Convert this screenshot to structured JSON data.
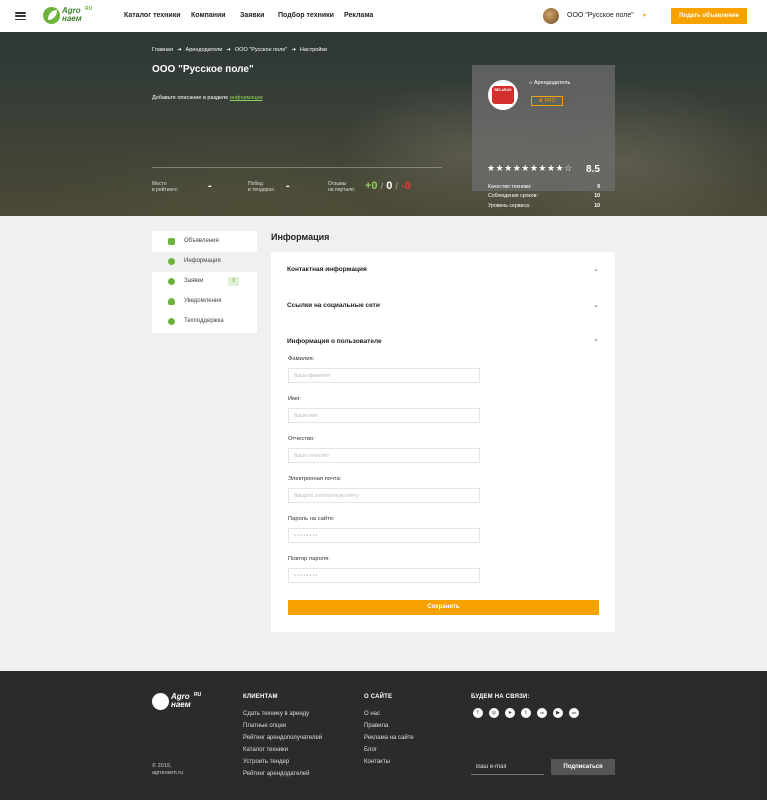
{
  "header": {
    "logo_text_1": "Agro",
    "logo_text_2": "наем",
    "logo_ru": "RU",
    "nav": [
      "Каталог техники",
      "Компании",
      "Заявки",
      "Подбор техники",
      "Реклама"
    ],
    "user_name": "ООО \"Русское поле\"",
    "post_button": "Подать объявление"
  },
  "hero": {
    "breadcrumbs": [
      "Главная",
      "Арендодатели",
      "ООО \"Русское поле\"",
      "Настройки"
    ],
    "title": "ООО \"Русское поле\"",
    "desc_prefix": "Добавьте описание в разделе",
    "desc_link": "информация",
    "stats": {
      "place_label_1": "Место",
      "place_label_2": "в рейтинге:",
      "place_value": "-",
      "wins_label_1": "Побед",
      "wins_label_2": "в тендерах:",
      "wins_value": "-",
      "reviews_label_1": "Отзывы",
      "reviews_label_2": "на портале:",
      "reviews_positive": "+0",
      "reviews_neutral": "0",
      "reviews_negative": "-0",
      "sep": "/"
    }
  },
  "card": {
    "brand": "BELARUS",
    "role": "Арендодатель",
    "badge": "PRO",
    "stars": "★★★★★★★★★☆",
    "score": "8.5",
    "criteria": [
      {
        "label": "Качество техники:",
        "value": "9"
      },
      {
        "label": "Соблюдение сроков:",
        "value": "10"
      },
      {
        "label": "Уровень сервиса:",
        "value": "10"
      }
    ]
  },
  "sidebar": {
    "items": [
      {
        "label": "Объявления"
      },
      {
        "label": "Информация"
      },
      {
        "label": "Заявки",
        "badge": "3"
      },
      {
        "label": "Уведомления"
      },
      {
        "label": "Техподдержка"
      }
    ]
  },
  "main": {
    "title": "Информация",
    "sections": [
      "Контактная информация",
      "Ссылки на социальные сети",
      "Информация о пользователе"
    ],
    "fields": [
      {
        "label": "Фамилия:",
        "placeholder": "Ваша фамилия"
      },
      {
        "label": "Имя:",
        "placeholder": "Ваше имя"
      },
      {
        "label": "Отчество:",
        "placeholder": "Ваше отчество"
      },
      {
        "label": "Электронная почта:",
        "placeholder": "Введите электронную почту"
      },
      {
        "label": "Пароль на сайте:",
        "placeholder": "• • • • • • • •"
      },
      {
        "label": "Повтор пароля:",
        "placeholder": "• • • • • • • •"
      }
    ],
    "save_button": "Сохранить"
  },
  "footer": {
    "logo_text_1": "Agro",
    "logo_text_2": "наем",
    "logo_ru": "RU",
    "clients_heading": "КЛИЕНТАМ",
    "clients_links": [
      "Сдать технику в аренду",
      "Платные опции",
      "Рейтинг арендополучателей",
      "Каталог техники",
      "Устроить тендер",
      "Рейтинг арендодателей"
    ],
    "about_heading": "О САЙТЕ",
    "about_links": [
      "О нас",
      "Правила",
      "Реклама на сайте",
      "Блог",
      "Контакты"
    ],
    "social_heading": "БУДЕМ НА СВЯЗИ:",
    "social": [
      "f",
      "◎",
      "➤",
      "t",
      "vk",
      "▶",
      "ok"
    ],
    "copyright_1": "© 2019,",
    "copyright_2": "agronaem.ru",
    "email_placeholder": "Ваш e-mail",
    "subscribe_button": "Подписаться"
  },
  "colors": {
    "accent": "#f7a200",
    "brand_green": "#6fb33f",
    "footer_bg": "#2b2b2b"
  }
}
